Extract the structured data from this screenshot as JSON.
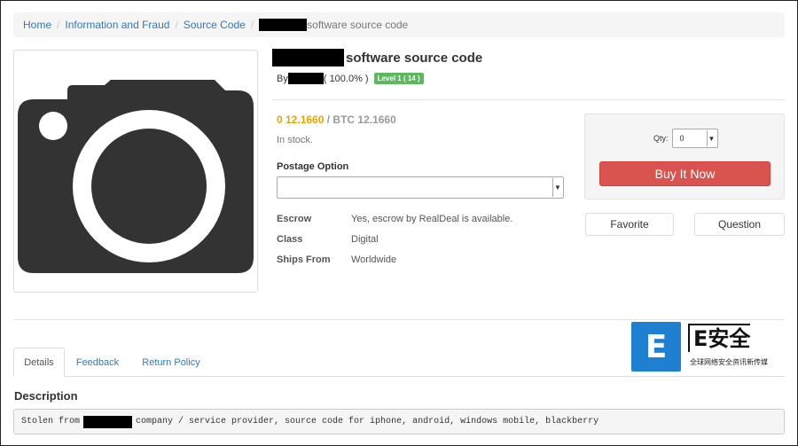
{
  "breadcrumb": {
    "items": [
      "Home",
      "Information and Fraud",
      "Source Code"
    ],
    "current": "software source code"
  },
  "product": {
    "title": "software source code",
    "by_label": "By",
    "rating": "( 100.0% )",
    "level_badge": "Level 1 ( 14 )",
    "price_fiat": "0 12.1660",
    "price_btc": "/ BTC 12.1660",
    "stock": "In stock.",
    "postage_label": "Postage Option",
    "postage_value": "",
    "specs": [
      {
        "key": "Escrow",
        "value": "Yes, escrow by RealDeal is available."
      },
      {
        "key": "Class",
        "value": "Digital"
      },
      {
        "key": "Ships From",
        "value": "Worldwide"
      }
    ]
  },
  "buybox": {
    "qty_label": "Qty:",
    "qty_value": "0",
    "buy_label": "Buy It Now",
    "favorite_label": "Favorite",
    "question_label": "Question"
  },
  "tabs": [
    {
      "label": "Details",
      "active": true
    },
    {
      "label": "Feedback",
      "active": false
    },
    {
      "label": "Return Policy",
      "active": false
    }
  ],
  "description": {
    "heading": "Description",
    "text_prefix": "Stolen from",
    "text_suffix": "company / service provider, source code for iphone, android, windows mobile, blackberry"
  },
  "watermark": {
    "logo_letter": "E",
    "brand": "E安全",
    "tagline": "全球网络安全资讯新传媒"
  },
  "colors": {
    "link": "#337ab7",
    "buy_button": "#d9534f",
    "level_badge": "#5cb85c",
    "price_fiat": "#e8a400"
  },
  "icons": {
    "product_image": "camera-icon"
  }
}
